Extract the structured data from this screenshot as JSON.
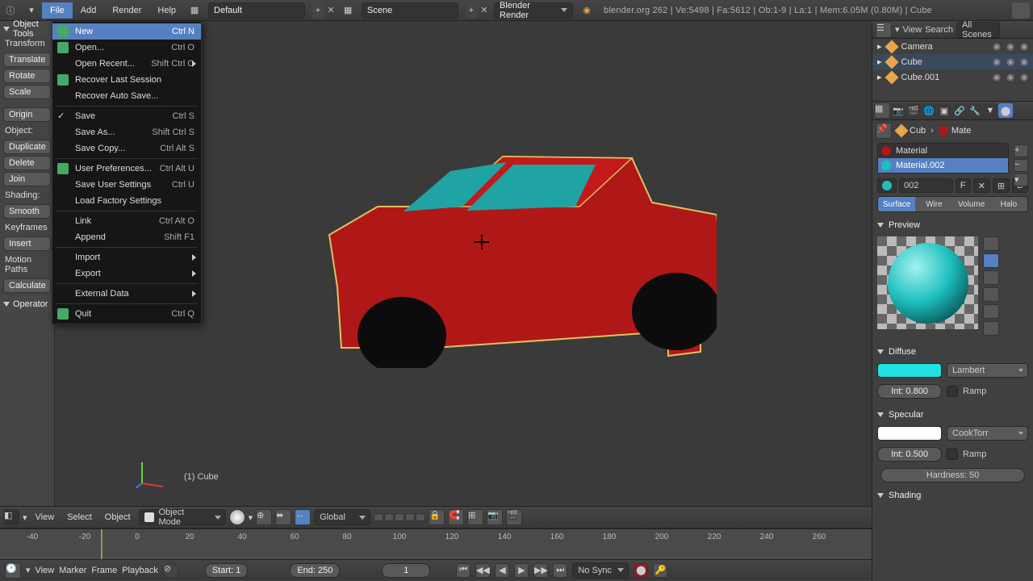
{
  "topbar": {
    "menus": [
      "File",
      "Add",
      "Render",
      "Help"
    ],
    "layout_field": "Default",
    "scene_field": "Scene",
    "engine_field": "Blender Render",
    "status": "blender.org 262 | Ve:5498 | Fa:5612 | Ob:1-9 | La:1 | Mem:6.05M (0.80M) | Cube"
  },
  "file_menu": {
    "items": [
      {
        "label": "New",
        "shortcut": "Ctrl N",
        "icon": "doc",
        "hi": true
      },
      {
        "label": "Open...",
        "shortcut": "Ctrl O",
        "icon": "folder"
      },
      {
        "label": "Open Recent...",
        "shortcut": "Shift Ctrl O",
        "arrow": true
      },
      {
        "label": "Recover Last Session",
        "icon": "recover"
      },
      {
        "label": "Recover Auto Save..."
      },
      {
        "sep": true
      },
      {
        "label": "Save",
        "shortcut": "Ctrl S",
        "check": true
      },
      {
        "label": "Save As...",
        "shortcut": "Shift Ctrl S"
      },
      {
        "label": "Save Copy...",
        "shortcut": "Ctrl Alt S"
      },
      {
        "sep": true
      },
      {
        "label": "User Preferences...",
        "shortcut": "Ctrl Alt U",
        "icon": "gear"
      },
      {
        "label": "Save User Settings",
        "shortcut": "Ctrl U"
      },
      {
        "label": "Load Factory Settings"
      },
      {
        "sep": true
      },
      {
        "label": "Link",
        "shortcut": "Ctrl Alt O"
      },
      {
        "label": "Append",
        "shortcut": "Shift F1"
      },
      {
        "sep": true
      },
      {
        "label": "Import",
        "arrow": true
      },
      {
        "label": "Export",
        "arrow": true
      },
      {
        "sep": true
      },
      {
        "label": "External Data",
        "arrow": true
      },
      {
        "sep": true
      },
      {
        "label": "Quit",
        "shortcut": "Ctrl Q",
        "icon": "power"
      }
    ]
  },
  "toolshelf": {
    "header": "Object Tools",
    "transform_label": "Transform",
    "translate": "Translate",
    "rotate": "Rotate",
    "scale": "Scale",
    "origin": "Origin",
    "object_label": "Object:",
    "duplicate": "Duplicate",
    "delete": "Delete",
    "join": "Join",
    "shading_label": "Shading:",
    "smooth": "Smooth",
    "keyframes_label": "Keyframes",
    "insert": "Insert",
    "motion_label": "Motion Paths",
    "calculate": "Calculate",
    "operator": "Operator"
  },
  "viewport": {
    "object_label": "(1) Cube",
    "header_menus": [
      "View",
      "Select",
      "Object"
    ],
    "mode": "Object Mode",
    "orientation": "Global"
  },
  "timeline": {
    "ticks": [
      "-40",
      "-20",
      "0",
      "20",
      "40",
      "60",
      "80",
      "100",
      "120",
      "140",
      "160",
      "180",
      "200",
      "220",
      "240",
      "260"
    ],
    "menus": [
      "View",
      "Marker",
      "Frame",
      "Playback"
    ],
    "start": "Start: 1",
    "end": "End: 250",
    "current": "1",
    "sync": "No Sync"
  },
  "outliner": {
    "search_label": "View",
    "search_btn": "Search",
    "filter": "All Scenes",
    "items": [
      {
        "label": "Camera",
        "color": "#e8a54b"
      },
      {
        "label": "Cube",
        "color": "#e8a54b",
        "sel": true
      },
      {
        "label": "Cube.001",
        "color": "#e8a54b"
      }
    ]
  },
  "props": {
    "crumb_obj": "Cub",
    "crumb_mat": "Mate",
    "material_slots": [
      {
        "name": "Material",
        "color": "#b01818"
      },
      {
        "name": "Material.002",
        "color": "#1fbfbf",
        "sel": true
      }
    ],
    "mat_id": "002",
    "mat_F": "F",
    "nodes": "D",
    "render_tabs": [
      "Surface",
      "Wire",
      "Volume",
      "Halo"
    ],
    "preview_label": "Preview",
    "diffuse_label": "Diffuse",
    "diffuse_color": "#22e0e0",
    "diffuse_shader": "Lambert",
    "diffuse_intensity": "Int: 0.800",
    "ramp_label": "Ramp",
    "specular_label": "Specular",
    "specular_color": "#ffffff",
    "specular_shader": "CookTorr",
    "specular_intensity": "Int: 0.500",
    "hardness": "Hardness: 50",
    "shading_label": "Shading"
  }
}
